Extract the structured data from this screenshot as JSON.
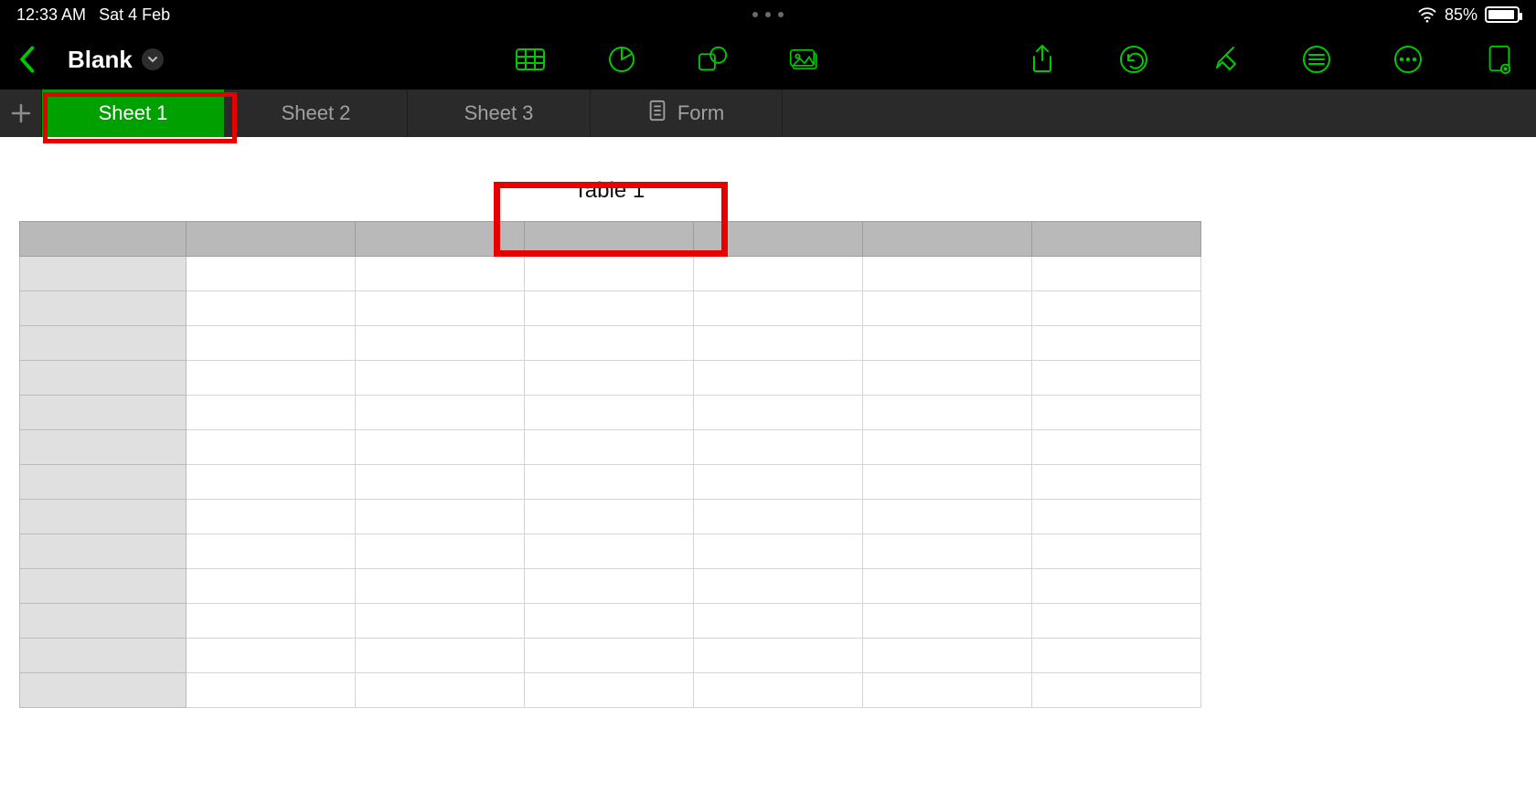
{
  "status": {
    "time": "12:33 AM",
    "date": "Sat 4 Feb",
    "battery_pct": "85%"
  },
  "header": {
    "doc_title": "Blank"
  },
  "sheet_tabs": {
    "t0": "Sheet 1",
    "t1": "Sheet 2",
    "t2": "Sheet 3",
    "form": "Form"
  },
  "table": {
    "title": "Table 1",
    "columns": 7,
    "rows": 13
  },
  "colors": {
    "accent": "#00c900",
    "tab_active": "#00a000",
    "annotation": "#e60000"
  }
}
